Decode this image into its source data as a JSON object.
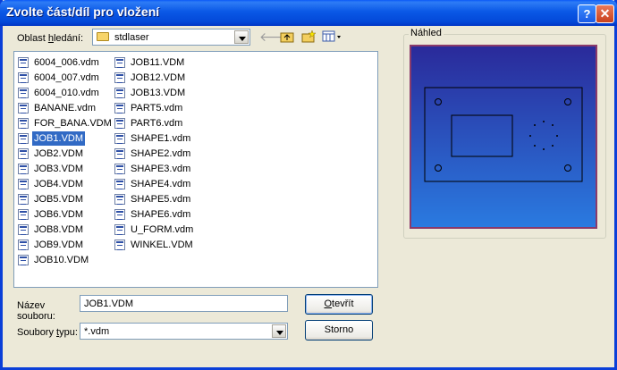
{
  "window": {
    "title": "Zvolte část/díl pro vložení",
    "help_icon": "help-icon",
    "close_icon": "close-icon"
  },
  "look_in": {
    "label_pre": "Oblast ",
    "label_u": "h",
    "label_post": "ledání:",
    "value": "stdlaser",
    "icon": "folder-icon"
  },
  "toolbar": {
    "icons": [
      "back-arrow-icon",
      "up-folder-icon",
      "new-folder-icon",
      "view-menu-icon"
    ]
  },
  "files": {
    "column1": [
      "6004_006.vdm",
      "6004_007.vdm",
      "6004_010.vdm",
      "BANANE.vdm",
      "FOR_BANA.VDM",
      "JOB1.VDM",
      "JOB2.VDM",
      "JOB3.VDM",
      "JOB4.VDM",
      "JOB5.VDM",
      "JOB6.VDM",
      "JOB8.VDM",
      "JOB9.VDM",
      "JOB10.VDM"
    ],
    "column2": [
      "JOB11.VDM",
      "JOB12.VDM",
      "JOB13.VDM",
      "PART5.vdm",
      "PART6.vdm",
      "SHAPE1.vdm",
      "SHAPE2.vdm",
      "SHAPE3.vdm",
      "SHAPE4.vdm",
      "SHAPE5.vdm",
      "SHAPE6.vdm",
      "U_FORM.vdm",
      "WINKEL.VDM"
    ],
    "selected": "JOB1.VDM",
    "icon": "vdm-file-icon"
  },
  "filename": {
    "label_line1": "Název",
    "label_line2": "souboru:",
    "value": "JOB1.VDM"
  },
  "filetype": {
    "label_pre": "Soubory ",
    "label_u": "t",
    "label_post": "ypu:",
    "value": "*.vdm"
  },
  "buttons": {
    "open_u": "O",
    "open_rest": "tevřít",
    "cancel": "Storno"
  },
  "preview": {
    "title": "Náhled",
    "bg_top": "#2a2a9a",
    "bg_bottom": "#2a7ae0",
    "frame_color": "#8a3a6a"
  }
}
